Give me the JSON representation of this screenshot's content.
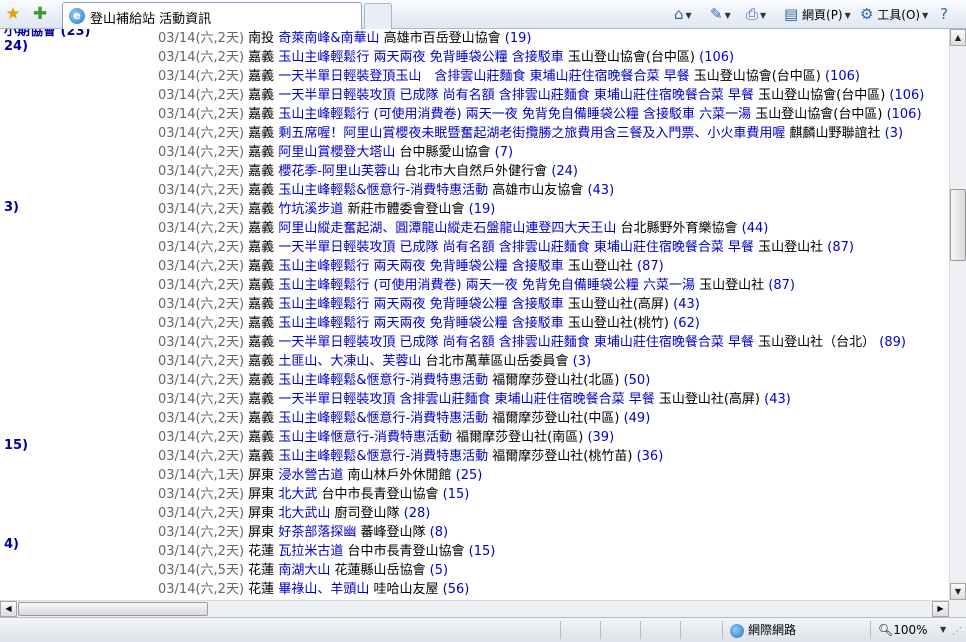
{
  "browser": {
    "tab_title": "登山補給站 活動資訊",
    "toolbar": {
      "page_label": "網頁(P)",
      "tools_label": "工具(O)"
    }
  },
  "left_column": [
    "24)",
    "3)",
    "15)",
    "4)"
  ],
  "top_partial": "小期協會 (23)",
  "rows": [
    {
      "date": "03/14(六,2天)",
      "region": "南投",
      "title": "奇萊南峰&南華山",
      "org": "高雄市百岳登山協會",
      "count": "(19)"
    },
    {
      "date": "03/14(六,2天)",
      "region": "嘉義",
      "title": "玉山主峰輕鬆行 兩天兩夜 免背睡袋公糧 含接駁車",
      "org": "玉山登山協會(台中區)",
      "count": "(106)"
    },
    {
      "date": "03/14(六,2天)",
      "region": "嘉義",
      "title": "一天半單日輕裝登頂玉山　含排雲山莊麵食 東埔山莊住宿晚餐合菜 早餐",
      "org": "玉山登山協會(台中區)",
      "count": "(106)"
    },
    {
      "date": "03/14(六,2天)",
      "region": "嘉義",
      "title": "一天半單日輕裝攻頂 已成隊 尚有名額 含排雲山莊麵食 東埔山莊住宿晚餐合菜 早餐",
      "org": "玉山登山協會(台中區)",
      "count": "(106)"
    },
    {
      "date": "03/14(六,2天)",
      "region": "嘉義",
      "title": "玉山主峰輕鬆行 (可使用消費卷) 兩天一夜 免背免自備睡袋公糧 含接駁車 六菜一湯",
      "org": "玉山登山協會(台中區)",
      "count": "(106)"
    },
    {
      "date": "03/14(六,2天)",
      "region": "嘉義",
      "title": "剩五席喔！阿里山賞櫻夜未眠暨奮起湖老街攬勝之旅費用含三餐及入門票、小火車費用喔",
      "org": "麒麟山野聯誼社",
      "count": "(3)"
    },
    {
      "date": "03/14(六,2天)",
      "region": "嘉義",
      "title": "阿里山賞櫻登大塔山",
      "org": "台中縣愛山協會",
      "count": "(7)"
    },
    {
      "date": "03/14(六,2天)",
      "region": "嘉義",
      "title": "櫻花季-阿里山芙蓉山",
      "org": "台北市大自然戶外健行會",
      "count": "(24)"
    },
    {
      "date": "03/14(六,2天)",
      "region": "嘉義",
      "title": "玉山主峰輕鬆&愜意行-消費特惠活動",
      "org": "高雄市山友協會",
      "count": "(43)"
    },
    {
      "date": "03/14(六,2天)",
      "region": "嘉義",
      "title": "竹坑溪步道",
      "org": "新莊市體委會登山會",
      "count": "(19)"
    },
    {
      "date": "03/14(六,2天)",
      "region": "嘉義",
      "title": "阿里山縱走奮起湖、圓潭龍山縱走石盤龍山連登四大天王山",
      "org": "台北縣野外育樂協會",
      "count": "(44)"
    },
    {
      "date": "03/14(六,2天)",
      "region": "嘉義",
      "title": "一天半單日輕裝攻頂 已成隊 尚有名額 含排雲山莊麵食 東埔山莊住宿晚餐合菜 早餐",
      "org": "玉山登山社",
      "count": "(87)"
    },
    {
      "date": "03/14(六,2天)",
      "region": "嘉義",
      "title": "玉山主峰輕鬆行 兩天兩夜 免背睡袋公糧 含接駁車",
      "org": "玉山登山社",
      "count": "(87)"
    },
    {
      "date": "03/14(六,2天)",
      "region": "嘉義",
      "title": "玉山主峰輕鬆行 (可使用消費卷) 兩天一夜 免背免自備睡袋公糧 六菜一湯",
      "org": "玉山登山社",
      "count": "(87)"
    },
    {
      "date": "03/14(六,2天)",
      "region": "嘉義",
      "title": "玉山主峰輕鬆行 兩天兩夜 免背睡袋公糧 含接駁車",
      "org": "玉山登山社(高屏)",
      "count": "(43)"
    },
    {
      "date": "03/14(六,2天)",
      "region": "嘉義",
      "title": "玉山主峰輕鬆行 兩天兩夜 免背睡袋公糧 含接駁車",
      "org": "玉山登山社(桃竹)",
      "count": "(62)"
    },
    {
      "date": "03/14(六,2天)",
      "region": "嘉義",
      "title": "一天半單日輕裝攻頂 已成隊 尚有名額 含排雲山莊麵食 東埔山莊住宿晚餐合菜 早餐",
      "org": "玉山登山社（台北）",
      "count": "(89)"
    },
    {
      "date": "03/14(六,2天)",
      "region": "嘉義",
      "title": "土匪山、大凍山、芙蓉山",
      "org": "台北市萬華區山岳委員會",
      "count": "(3)"
    },
    {
      "date": "03/14(六,2天)",
      "region": "嘉義",
      "title": "玉山主峰輕鬆&愜意行-消費特惠活動",
      "org": "福爾摩莎登山社(北區)",
      "count": "(50)"
    },
    {
      "date": "03/14(六,2天)",
      "region": "嘉義",
      "title": "一天半單日輕裝攻頂 含排雲山莊麵食 東埔山莊住宿晚餐合菜 早餐",
      "org": "玉山登山社(高屏)",
      "count": "(43)"
    },
    {
      "date": "03/14(六,2天)",
      "region": "嘉義",
      "title": "玉山主峰輕鬆&愜意行-消費特惠活動",
      "org": "福爾摩莎登山社(中區)",
      "count": "(49)"
    },
    {
      "date": "03/14(六,2天)",
      "region": "嘉義",
      "title": "玉山主峰愜意行-消費特惠活動",
      "org": "福爾摩莎登山社(南區)",
      "count": "(39)"
    },
    {
      "date": "03/14(六,2天)",
      "region": "嘉義",
      "title": "玉山主峰輕鬆&愜意行-消費特惠活動",
      "org": "福爾摩莎登山社(桃竹苗)",
      "count": "(36)"
    },
    {
      "date": "03/14(六,1天)",
      "region": "屏東",
      "title": "浸水營古道",
      "org": "南山林戶外休閒館",
      "count": "(25)"
    },
    {
      "date": "03/14(六,2天)",
      "region": "屏東",
      "title": "北大武",
      "org": "台中市長青登山協會",
      "count": "(15)"
    },
    {
      "date": "03/14(六,2天)",
      "region": "屏東",
      "title": "北大武山",
      "org": "廚司登山隊",
      "count": "(28)"
    },
    {
      "date": "03/14(六,2天)",
      "region": "屏東",
      "title": "好茶部落探幽",
      "org": "蕃峰登山隊",
      "count": "(8)"
    },
    {
      "date": "03/14(六,2天)",
      "region": "花蓮",
      "title": "瓦拉米古道",
      "org": "台中市長青登山協會",
      "count": "(15)"
    },
    {
      "date": "03/14(六,5天)",
      "region": "花蓮",
      "title": "南湖大山",
      "org": "花蓮縣山岳協會",
      "count": "(5)"
    },
    {
      "date": "03/14(六,2天)",
      "region": "花蓮",
      "title": "畢祿山、羊頭山",
      "org": "哇哈山友屋",
      "count": "(56)"
    }
  ],
  "status": {
    "zone": "網際網路",
    "zoom": "100%"
  }
}
